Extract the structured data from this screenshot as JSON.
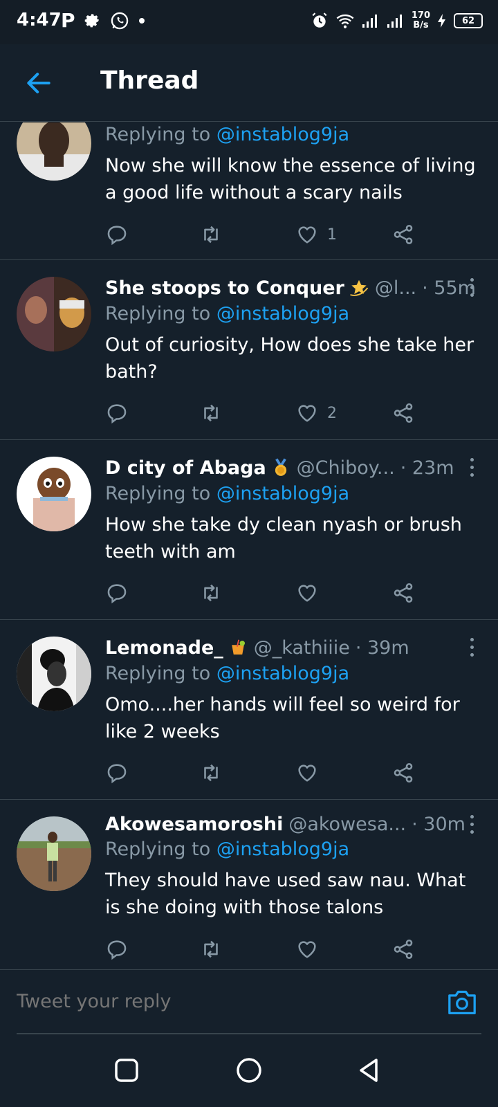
{
  "status_bar": {
    "time": "4:47",
    "p_icon": "P",
    "speed_top": "170",
    "speed_bottom": "B/s",
    "battery": "62"
  },
  "header": {
    "title": "Thread"
  },
  "tweets": [
    {
      "name": "",
      "handle": "",
      "time": "",
      "reply_prefix": "Replying to ",
      "reply_to": "@instablog9ja",
      "text": "Now she will know the essence of living a good life without a scary nails",
      "likes": "1"
    },
    {
      "name": "She stoops to Conquer",
      "handle": "@l...",
      "time": "· 55m",
      "reply_prefix": "Replying to ",
      "reply_to": "@instablog9ja",
      "text": "Out of curiosity, How does she take her bath?",
      "likes": "2"
    },
    {
      "name": "D city of Abaga",
      "handle": "@Chiboy...",
      "time": "· 23m",
      "reply_prefix": "Replying to ",
      "reply_to": "@instablog9ja",
      "text": "How she take dy clean nyash or brush teeth with am",
      "likes": ""
    },
    {
      "name": "Lemonade_",
      "handle": "@_kathiiie",
      "time": "· 39m",
      "reply_prefix": "Replying to ",
      "reply_to": "@instablog9ja",
      "text": "Omo....her hands will feel so weird for like 2 weeks",
      "likes": ""
    },
    {
      "name": "Akowesamoroshi",
      "handle": "@akowesa...",
      "time": "· 30m",
      "reply_prefix": "Replying to ",
      "reply_to": "@instablog9ja",
      "text": "They should have used saw nau. What is she doing with those talons",
      "likes": ""
    }
  ],
  "compose": {
    "placeholder": "Tweet your reply"
  },
  "colors": {
    "background": "#15202b",
    "accent": "#1da1f2",
    "secondary_text": "#8899a6"
  }
}
